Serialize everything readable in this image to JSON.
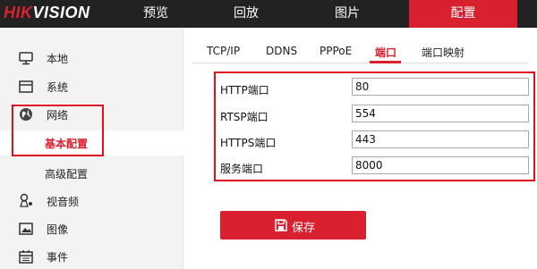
{
  "brand": {
    "prefix": "HIK",
    "suffix": "VISION"
  },
  "nav": [
    {
      "label": "预览"
    },
    {
      "label": "回放"
    },
    {
      "label": "图片"
    },
    {
      "label": "配置"
    }
  ],
  "sidebar": {
    "local": "本地",
    "system": "系统",
    "network": "网络",
    "network_basic": "基本配置",
    "network_advanced": "高级配置",
    "video_audio": "视音频",
    "image": "图像",
    "event": "事件"
  },
  "tabs": [
    {
      "label": "TCP/IP"
    },
    {
      "label": "DDNS"
    },
    {
      "label": "PPPoE"
    },
    {
      "label": "端口"
    },
    {
      "label": "端口映射"
    }
  ],
  "ports": [
    {
      "label": "HTTP端口",
      "value": "80"
    },
    {
      "label": "RTSP端口",
      "value": "554"
    },
    {
      "label": "HTTPS端口",
      "value": "443"
    },
    {
      "label": "服务端口",
      "value": "8000"
    }
  ],
  "save_label": "保存",
  "colors": {
    "accent": "#d9202f",
    "topbar": "#222222",
    "highlight": "#e0101e",
    "sidebar_bg": "#f3f3f3"
  }
}
